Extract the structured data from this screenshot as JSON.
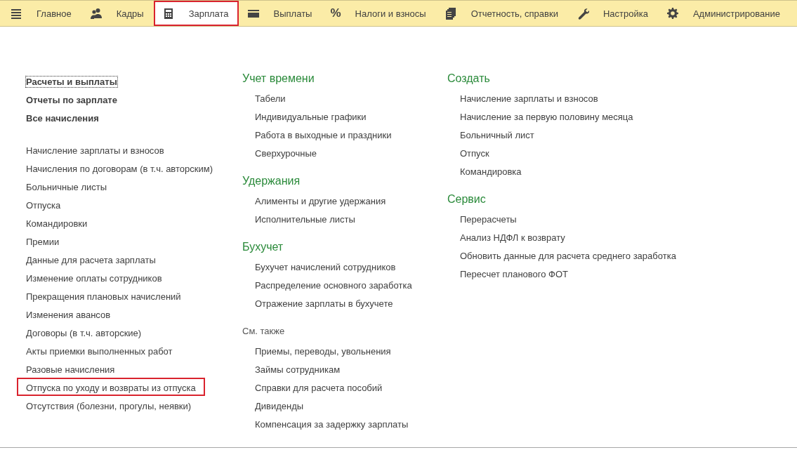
{
  "tabs": [
    {
      "label": "Главное",
      "kind": "menu",
      "selected": false,
      "highlighted": false
    },
    {
      "label": "Кадры",
      "kind": "people",
      "selected": false,
      "highlighted": false
    },
    {
      "label": "Зарплата",
      "kind": "calculator",
      "selected": true,
      "highlighted": true
    },
    {
      "label": "Выплаты",
      "kind": "card",
      "selected": false,
      "highlighted": false
    },
    {
      "label": "Налоги и взносы",
      "kind": "glyph",
      "glyph": "%",
      "selected": false,
      "highlighted": false
    },
    {
      "label": "Отчетность, справки",
      "kind": "documents",
      "selected": false,
      "highlighted": false
    },
    {
      "label": "Настройка",
      "kind": "wrench",
      "selected": false,
      "highlighted": false
    },
    {
      "label": "Администрирование",
      "kind": "gear",
      "selected": false,
      "highlighted": false
    }
  ],
  "column_1": {
    "primary": [
      {
        "label": "Расчеты и выплаты",
        "focused": true,
        "highlighted": false
      },
      {
        "label": "Отчеты по зарплате",
        "focused": false,
        "highlighted": false
      },
      {
        "label": "Все начисления",
        "focused": false,
        "highlighted": false
      }
    ],
    "secondary": [
      {
        "label": "Начисление зарплаты и взносов",
        "focused": false,
        "highlighted": false
      },
      {
        "label": "Начисления по договорам (в т.ч. авторским)",
        "focused": false,
        "highlighted": false
      },
      {
        "label": "Больничные листы",
        "focused": false,
        "highlighted": false
      },
      {
        "label": "Отпуска",
        "focused": false,
        "highlighted": false
      },
      {
        "label": "Командировки",
        "focused": false,
        "highlighted": false
      },
      {
        "label": "Премии",
        "focused": false,
        "highlighted": false
      },
      {
        "label": "Данные для расчета зарплаты",
        "focused": false,
        "highlighted": false
      },
      {
        "label": "Изменение оплаты сотрудников",
        "focused": false,
        "highlighted": false
      },
      {
        "label": "Прекращения плановых начислений",
        "focused": false,
        "highlighted": false
      },
      {
        "label": "Изменения авансов",
        "focused": false,
        "highlighted": false
      },
      {
        "label": "Договоры (в т.ч. авторские)",
        "focused": false,
        "highlighted": false
      },
      {
        "label": "Акты приемки выполненных работ",
        "focused": false,
        "highlighted": false
      },
      {
        "label": "Разовые начисления",
        "focused": false,
        "highlighted": false
      },
      {
        "label": "Отпуска по уходу и возвраты из отпуска",
        "focused": false,
        "highlighted": true
      },
      {
        "label": "Отсутствия (болезни, прогулы, неявки)",
        "focused": false,
        "highlighted": false
      }
    ]
  },
  "column_2": [
    {
      "title": "Учет времени",
      "kind": "section",
      "items": [
        "Табели",
        "Индивидуальные графики",
        "Работа в выходные и праздники",
        "Сверхурочные"
      ]
    },
    {
      "title": "Удержания",
      "kind": "section",
      "items": [
        "Алименты и другие удержания",
        "Исполнительные листы"
      ]
    },
    {
      "title": "Бухучет",
      "kind": "section",
      "items": [
        "Бухучет начислений сотрудников",
        "Распределение основного заработка",
        "Отражение зарплаты в бухучете"
      ]
    },
    {
      "title": "См. также",
      "kind": "see_also",
      "items": [
        "Приемы, переводы, увольнения",
        "Займы сотрудникам",
        "Справки для расчета пособий",
        "Дивиденды",
        "Компенсация за задержку зарплаты"
      ]
    }
  ],
  "column_3": [
    {
      "title": "Создать",
      "kind": "section",
      "items": [
        "Начисление зарплаты и взносов",
        "Начисление за первую половину месяца",
        "Больничный лист",
        "Отпуск",
        "Командировка"
      ]
    },
    {
      "title": "Сервис",
      "kind": "section",
      "items": [
        "Перерасчеты",
        "Анализ НДФЛ к возврату",
        "Обновить данные для расчета среднего заработка",
        "Пересчет планового ФОТ"
      ]
    }
  ]
}
